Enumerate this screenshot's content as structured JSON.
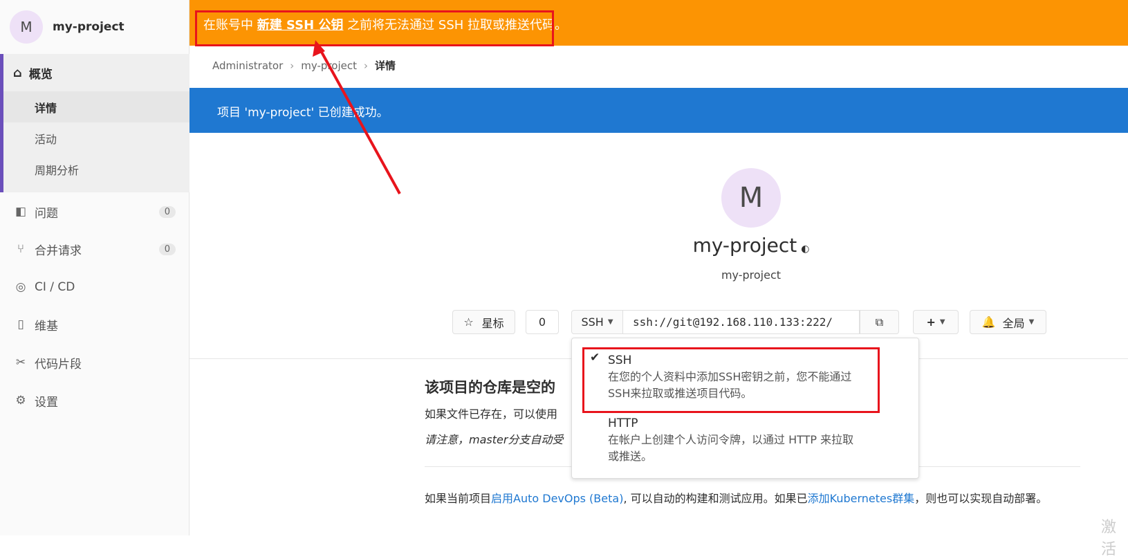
{
  "sidebar": {
    "avatar_letter": "M",
    "project_name": "my-project",
    "overview": {
      "label": "概览",
      "subitems": [
        "详情",
        "活动",
        "周期分析"
      ]
    },
    "items": [
      {
        "label": "问题",
        "count": "0"
      },
      {
        "label": "合并请求",
        "count": "0"
      },
      {
        "label": "CI / CD"
      },
      {
        "label": "维基"
      },
      {
        "label": "代码片段"
      },
      {
        "label": "设置"
      }
    ]
  },
  "warning": {
    "prefix": "在账号中",
    "link": "新建 SSH 公钥",
    "suffix": "之前将无法通过 SSH 拉取或推送代码。"
  },
  "breadcrumb": [
    "Administrator",
    "my-project",
    "详情"
  ],
  "flash": "项目 'my-project' 已创建成功。",
  "project": {
    "avatar_letter": "M",
    "title": "my-project",
    "subtitle": "my-project"
  },
  "controls": {
    "star_label": "星标",
    "star_count": "0",
    "protocol": "SSH",
    "clone_url": "ssh://git@192.168.110.133:222/",
    "notify_label": "全局"
  },
  "dropdown": {
    "ssh_title": "SSH",
    "ssh_desc_1": "在您的个人资料中添加SSH密钥之前，您不能通过",
    "ssh_desc_2": "SSH来拉取或推送项目代码。",
    "http_title": "HTTP",
    "http_desc_1": "在帐户上创建个人访问令牌，以通过 HTTP 来拉取",
    "http_desc_2": "或推送。"
  },
  "empty": {
    "heading": "该项目的仓库是空的",
    "p1": "如果文件已存在，可以使用",
    "p2": "请注意，master分支自动受",
    "devops_pre": "如果当前项目",
    "devops_link1": "启用Auto DevOps (Beta)",
    "devops_mid": ", 可以自动的构建和测试应用。如果已",
    "devops_link2": "添加Kubernetes群集",
    "devops_post": "，则也可以实现自动部署。"
  },
  "watermark": "激活"
}
